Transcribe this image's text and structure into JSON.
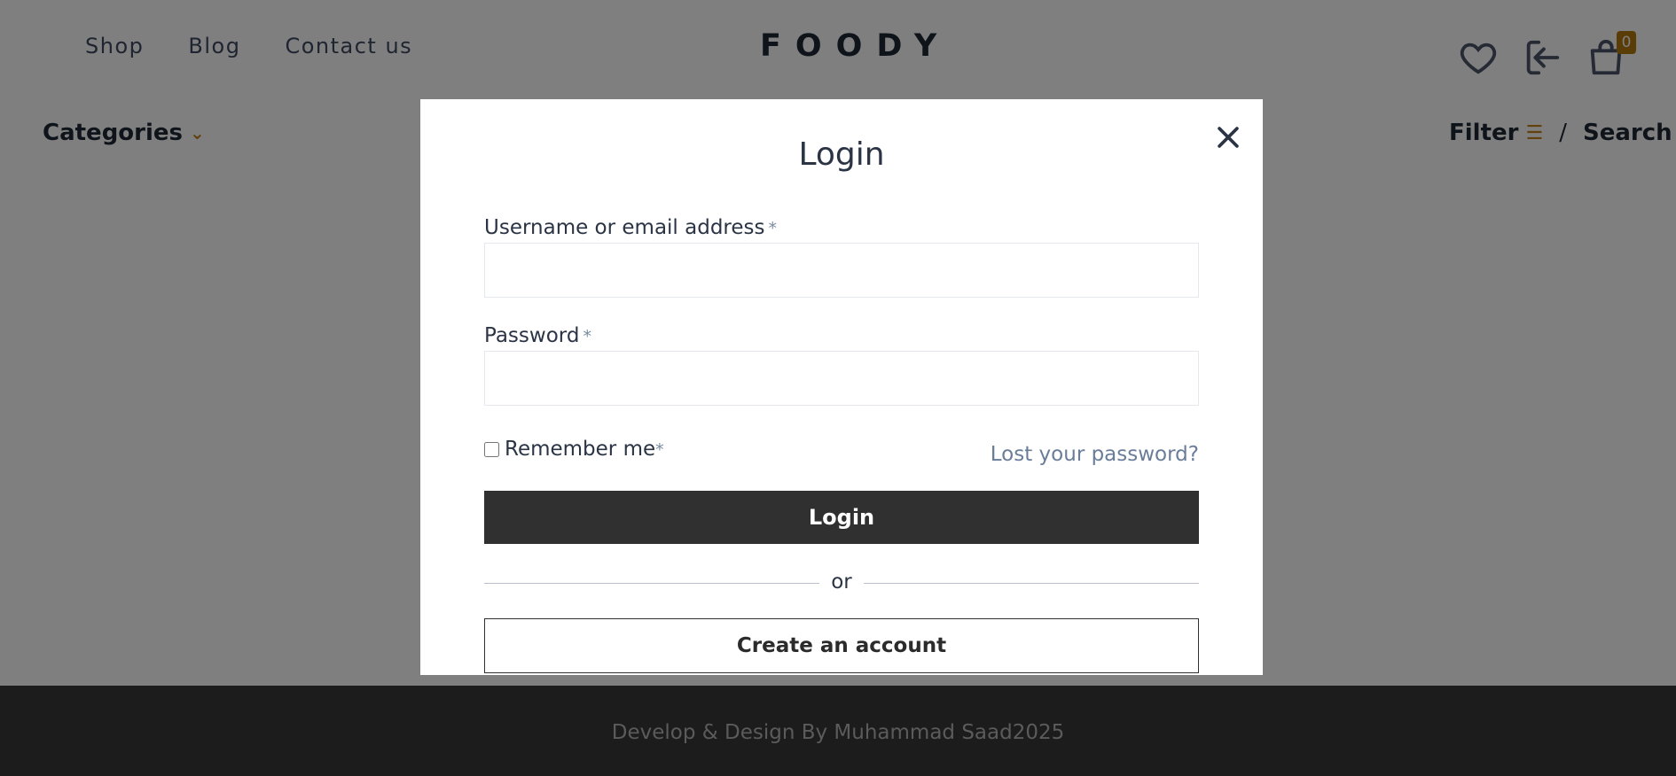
{
  "header": {
    "nav": [
      "Shop",
      "Blog",
      "Contact us"
    ],
    "logo": "FOODY",
    "cart_count": "0",
    "icons": [
      "heart-icon",
      "login-icon",
      "shopping-bag-icon"
    ]
  },
  "toolbar": {
    "categories_label": "Categories",
    "filter_label": "Filter",
    "separator": "/",
    "search_label": "Search"
  },
  "modal": {
    "title": "Login",
    "username_label": "Username or email address",
    "password_label": "Password",
    "required_mark": "*",
    "remember_label": "Remember me",
    "lost_password": "Lost your password?",
    "login_button": "Login",
    "or_text": "or",
    "create_account": "Create an account"
  },
  "footer": {
    "text": "Develop & Design By Muhammad Saad2025"
  },
  "colors": {
    "accent": "#c2841a",
    "button_dark": "#303030",
    "overlay": "rgba(0,0,0,0.5)",
    "footer_bg": "#1c1c1c"
  }
}
